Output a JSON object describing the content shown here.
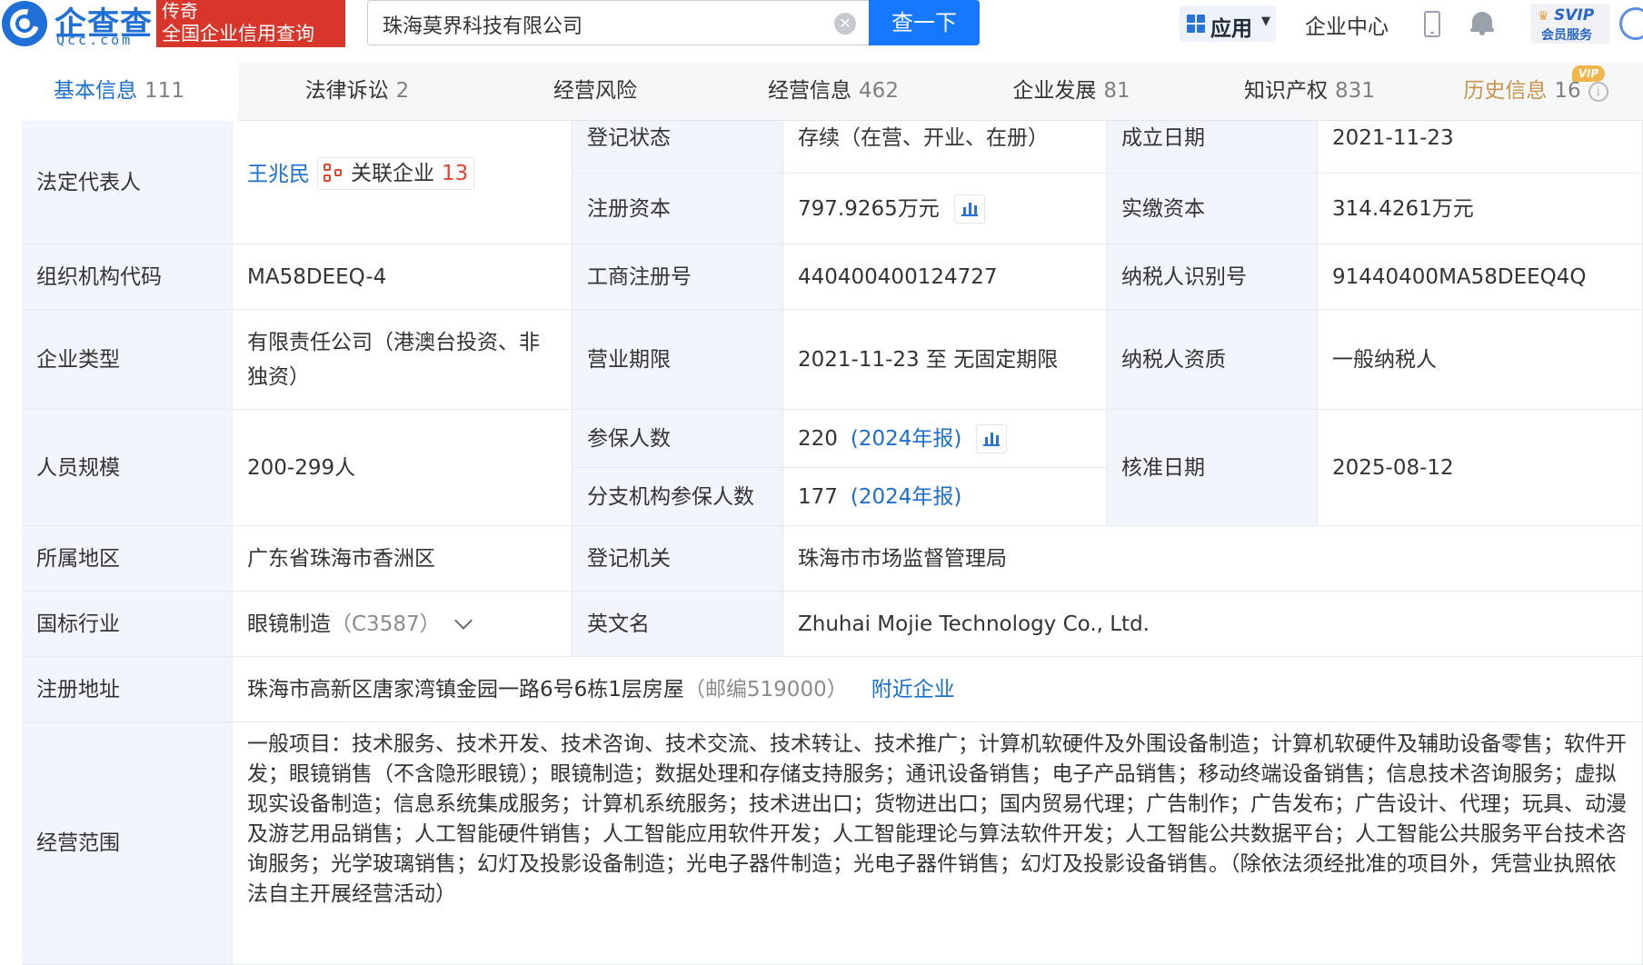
{
  "header": {
    "logo_name": "企查查",
    "logo_domain": "Qcc.com",
    "promo_title": "传奇",
    "promo_sub": "全国企业信用查询",
    "search_value": "珠海莫界科技有限公司",
    "search_button": "查一下",
    "apps_label": "应用",
    "enterprise_center": "企业中心",
    "svip_label": "SVIP",
    "svip_sub": "会员服务"
  },
  "tabs": [
    {
      "label": "基本信息",
      "count": "111"
    },
    {
      "label": "法律诉讼",
      "count": "2"
    },
    {
      "label": "经营风险",
      "count": ""
    },
    {
      "label": "经营信息",
      "count": "462"
    },
    {
      "label": "企业发展",
      "count": "81"
    },
    {
      "label": "知识产权",
      "count": "831"
    },
    {
      "label": "历史信息",
      "count": "16"
    }
  ],
  "vip_badge": "VIP",
  "info": {
    "legal_rep_label": "法定代表人",
    "legal_rep_name": "王兆民",
    "related_label": "关联企业",
    "related_count": "13",
    "status_label": "登记状态",
    "status_value": "存续（在营、开业、在册）",
    "found_label": "成立日期",
    "found_value": "2021-11-23",
    "reg_capital_label": "注册资本",
    "reg_capital_value": "797.9265万元",
    "paid_capital_label": "实缴资本",
    "paid_capital_value": "314.4261万元",
    "org_code_label": "组织机构代码",
    "org_code_value": "MA58DEEQ-4",
    "biz_reg_label": "工商注册号",
    "biz_reg_value": "440400400124727",
    "tax_id_label": "纳税人识别号",
    "tax_id_value": "91440400MA58DEEQ4Q",
    "type_label": "企业类型",
    "type_value": "有限责任公司（港澳台投资、非独资）",
    "term_label": "营业期限",
    "term_value": "2021-11-23 至 无固定期限",
    "taxpayer_label": "纳税人资质",
    "taxpayer_value": "一般纳税人",
    "staff_label": "人员规模",
    "staff_value": "200-299人",
    "insured_label": "参保人数",
    "insured_value": "220",
    "insured_year": "(2024年报)",
    "branch_label": "分支机构参保人数",
    "branch_value": "177",
    "branch_year": "(2024年报)",
    "approve_label": "核准日期",
    "approve_value": "2025-08-12",
    "region_label": "所属地区",
    "region_value": "广东省珠海市香洲区",
    "authority_label": "登记机关",
    "authority_value": "珠海市市场监督管理局",
    "industry_label": "国标行业",
    "industry_value": "眼镜制造",
    "industry_code": "（C3587）",
    "english_label": "英文名",
    "english_value": "Zhuhai Mojie Technology Co., Ltd.",
    "address_label": "注册地址",
    "address_value": "珠海市高新区唐家湾镇金园一路6号6栋1层房屋",
    "address_zip": "（邮编519000）",
    "nearby_link": "附近企业",
    "scope_label": "经营范围",
    "scope_value": "一般项目：技术服务、技术开发、技术咨询、技术交流、技术转让、技术推广；计算机软硬件及外围设备制造；计算机软硬件及辅助设备零售；软件开发；眼镜销售（不含隐形眼镜）；眼镜制造；数据处理和存储支持服务；通讯设备销售；电子产品销售；移动终端设备销售；信息技术咨询服务；虚拟现实设备制造；信息系统集成服务；计算机系统服务；技术进出口；货物进出口；国内贸易代理；广告制作；广告发布；广告设计、代理；玩具、动漫及游艺用品销售；人工智能硬件销售；人工智能应用软件开发；人工智能理论与算法软件开发；人工智能公共数据平台；人工智能公共服务平台技术咨询服务；光学玻璃销售；幻灯及投影设备制造；光电子器件制造；光电子器件销售；幻灯及投影设备销售。（除依法须经批准的项目外，凭营业执照依法自主开展经营活动）"
  }
}
